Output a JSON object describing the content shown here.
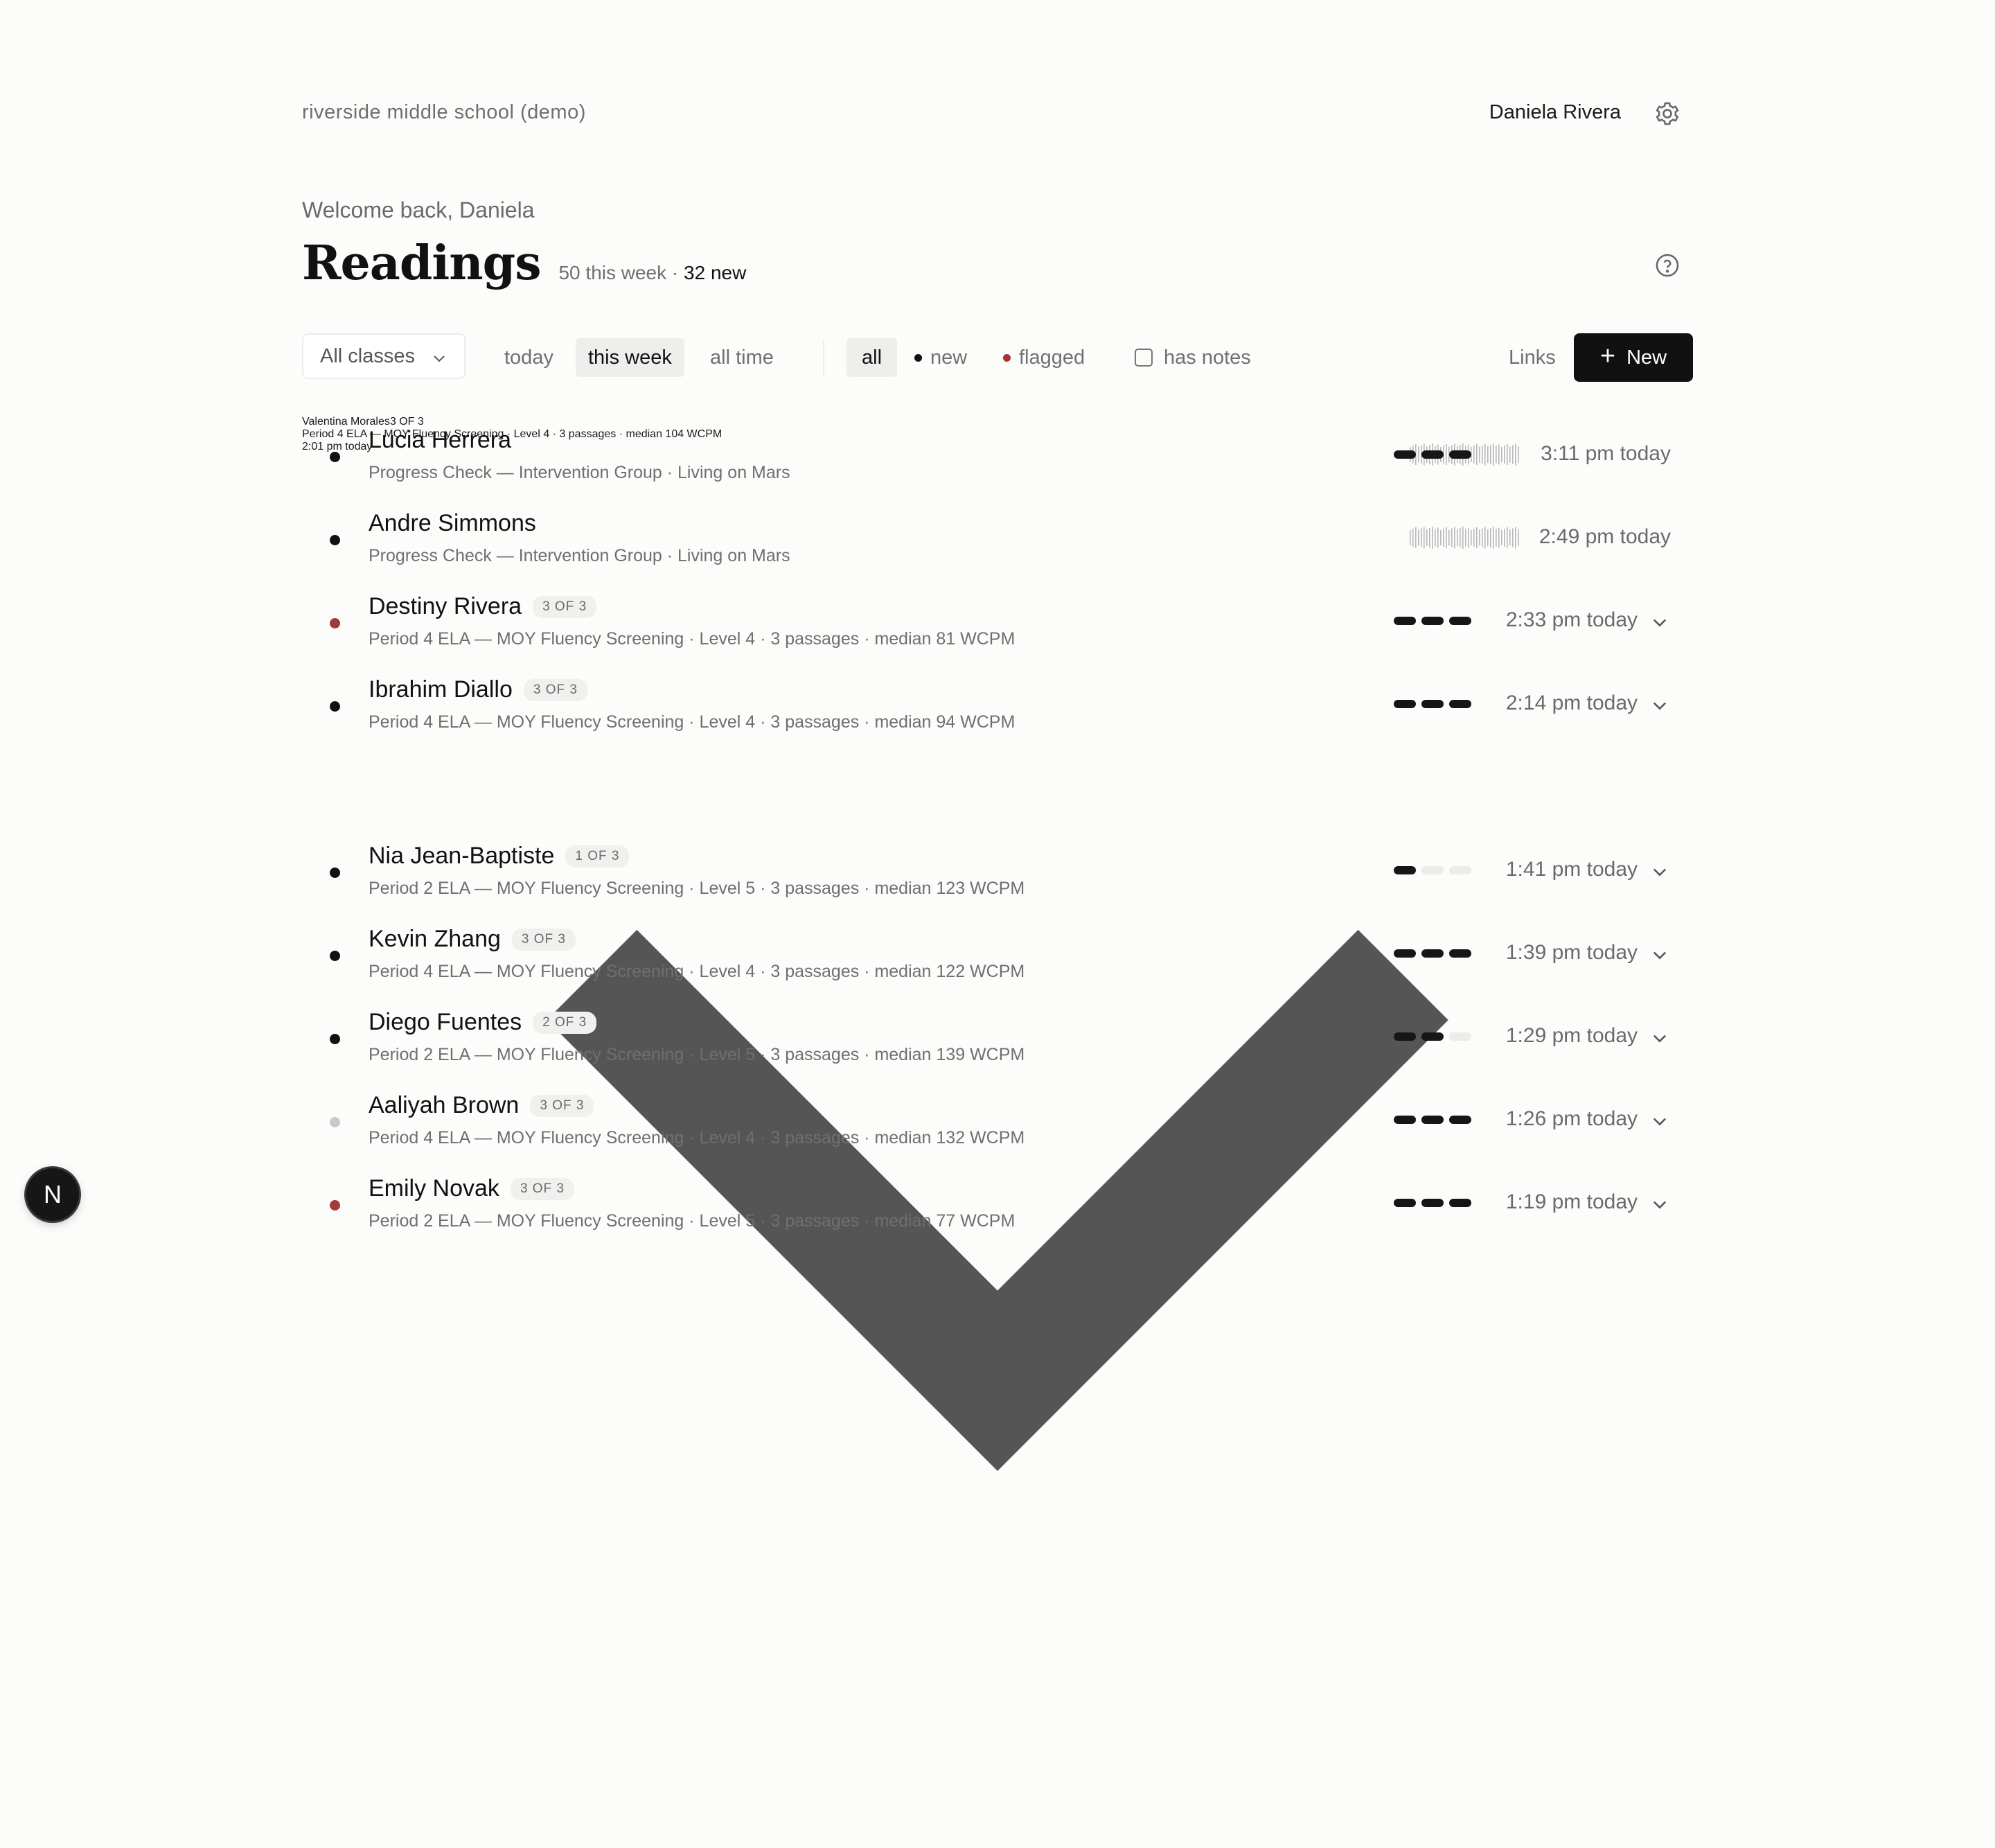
{
  "header": {
    "school": "riverside middle school (demo)",
    "user_name": "Daniela Rivera",
    "settings_icon": "gear-icon"
  },
  "hero": {
    "welcome": "Welcome back, Daniela",
    "title": "Readings",
    "week_count": "50 this week",
    "separator": "·",
    "new_count": "32 new",
    "help_icon": "help-circle-icon"
  },
  "filters": {
    "class_select": "All classes",
    "time_ranges": [
      {
        "label": "today",
        "active": false
      },
      {
        "label": "this week",
        "active": true
      },
      {
        "label": "all time",
        "active": false
      }
    ],
    "status": [
      {
        "label": "all",
        "active": true
      },
      {
        "label": "new",
        "dot": "#111111"
      },
      {
        "label": "flagged",
        "dot": "#a83232"
      }
    ],
    "has_notes": "has notes",
    "links": "Links",
    "new_button": "New"
  },
  "colors": {
    "dot_new": "#111111",
    "dot_flagged": "#a33a3a",
    "dot_seen": "#c9c9c9",
    "pass_done": "#161616",
    "pass_empty": "#ececea",
    "wave": "#b8b8b8"
  },
  "readings": [
    {
      "name": "Lucia Herrera",
      "badge": "",
      "subtitle": "Progress Check — Intervention Group · Living on Mars",
      "time": "3:11 pm today",
      "status": "new",
      "indicator": "waveform",
      "expandable": false
    },
    {
      "name": "Andre Simmons",
      "badge": "",
      "subtitle": "Progress Check — Intervention Group · Living on Mars",
      "time": "2:49 pm today",
      "status": "new",
      "indicator": "waveform",
      "expandable": false
    },
    {
      "name": "Destiny Rivera",
      "badge": "3 OF 3",
      "subtitle": "Period 4 ELA — MOY Fluency Screening · Level 4 · 3 passages · median 81 WCPM",
      "time": "2:33 pm today",
      "status": "flagged",
      "indicator": "passes",
      "passes_done": 3,
      "passes_total": 3,
      "expandable": true
    },
    {
      "name": "Ibrahim Diallo",
      "badge": "3 OF 3",
      "subtitle": "Period 4 ELA — MOY Fluency Screening · Level 4 · 3 passages · median 94 WCPM",
      "time": "2:14 pm today",
      "status": "new",
      "indicator": "passes",
      "passes_done": 3,
      "passes_total": 3,
      "expandable": true
    },
    {
      "name": "Valentina Morales",
      "badge": "3 OF 3",
      "subtitle": "Period 4 ELA — MOY Fluency Screening · Level 4 · 3 passages · median 104 WCPM",
      "time": "2:01 pm today",
      "status": "new",
      "indicator": "passes",
      "passes_done": 3,
      "passes_total": 3,
      "expandable": true,
      "highlighted": true
    },
    {
      "name": "Nia Jean-Baptiste",
      "badge": "1 OF 3",
      "subtitle": "Period 2 ELA — MOY Fluency Screening · Level 5 · 3 passages · median 123 WCPM",
      "time": "1:41 pm today",
      "status": "new",
      "indicator": "passes",
      "passes_done": 1,
      "passes_total": 3,
      "expandable": true
    },
    {
      "name": "Kevin Zhang",
      "badge": "3 OF 3",
      "subtitle": "Period 4 ELA — MOY Fluency Screening · Level 4 · 3 passages · median 122 WCPM",
      "time": "1:39 pm today",
      "status": "new",
      "indicator": "passes",
      "passes_done": 3,
      "passes_total": 3,
      "expandable": true
    },
    {
      "name": "Diego Fuentes",
      "badge": "2 OF 3",
      "subtitle": "Period 2 ELA — MOY Fluency Screening · Level 5 · 3 passages · median 139 WCPM",
      "time": "1:29 pm today",
      "status": "new",
      "indicator": "passes",
      "passes_done": 2,
      "passes_total": 3,
      "expandable": true
    },
    {
      "name": "Aaliyah Brown",
      "badge": "3 OF 3",
      "subtitle": "Period 4 ELA — MOY Fluency Screening · Level 4 · 3 passages · median 132 WCPM",
      "time": "1:26 pm today",
      "status": "seen",
      "indicator": "passes",
      "passes_done": 3,
      "passes_total": 3,
      "expandable": true
    },
    {
      "name": "Emily Novak",
      "badge": "3 OF 3",
      "subtitle": "Period 2 ELA — MOY Fluency Screening · Level 5 · 3 passages · median 77 WCPM",
      "time": "1:19 pm today",
      "status": "flagged",
      "indicator": "passes",
      "passes_done": 3,
      "passes_total": 3,
      "expandable": true
    }
  ],
  "dev_badge": "N"
}
